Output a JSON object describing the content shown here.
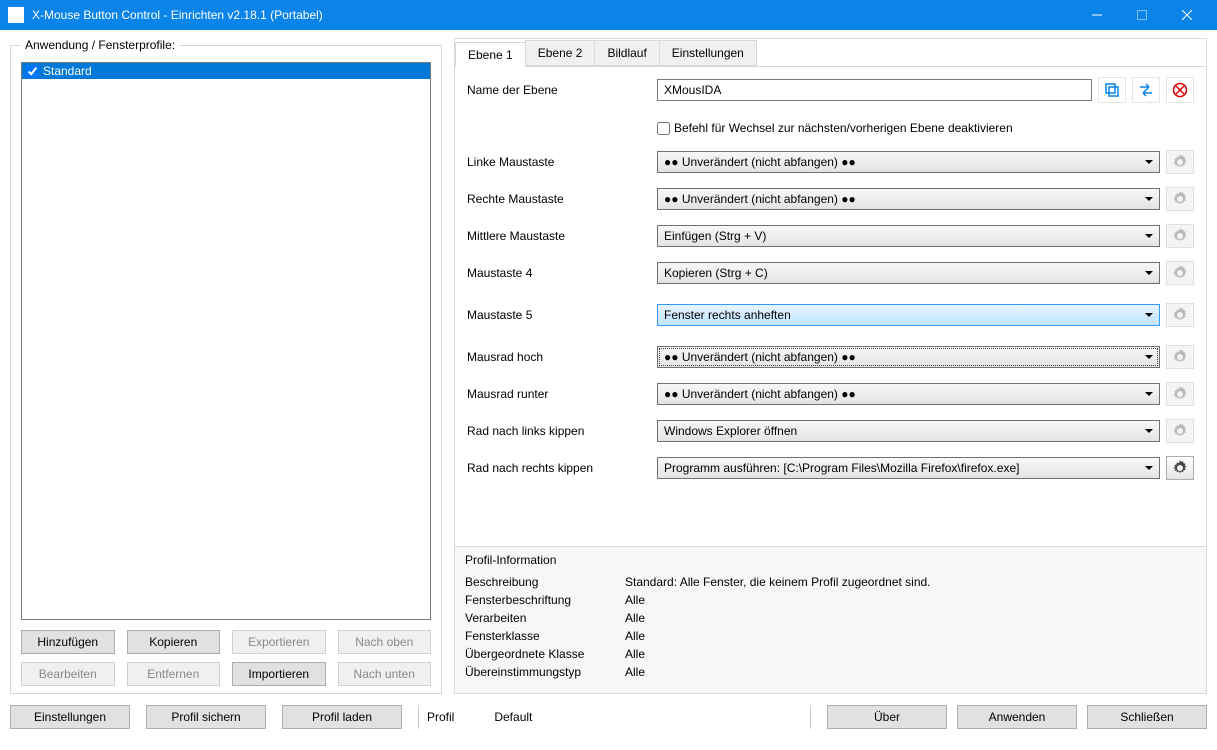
{
  "window": {
    "title": "X-Mouse Button Control - Einrichten v2.18.1 (Portabel)"
  },
  "leftPanel": {
    "legend": "Anwendung / Fensterprofile:",
    "items": [
      {
        "label": "Standard",
        "checked": true,
        "selected": true
      }
    ],
    "buttons": {
      "add": "Hinzufügen",
      "copy": "Kopieren",
      "export": "Exportieren",
      "moveUp": "Nach oben",
      "edit": "Bearbeiten",
      "remove": "Entfernen",
      "import": "Importieren",
      "moveDown": "Nach unten"
    }
  },
  "tabs": {
    "layer1": "Ebene 1",
    "layer2": "Ebene 2",
    "scroll": "Bildlauf",
    "settings": "Einstellungen"
  },
  "layerForm": {
    "nameLabel": "Name der Ebene",
    "nameValue": "XMousIDA",
    "disableSwitchLabel": "Befehl für Wechsel zur nächsten/vorherigen Ebene deaktivieren",
    "rows": [
      {
        "label": "Linke Maustaste",
        "value": "●● Unverändert (nicht abfangen) ●●",
        "gearEnabled": false,
        "highlight": false,
        "dashed": false
      },
      {
        "label": "Rechte Maustaste",
        "value": "●● Unverändert (nicht abfangen) ●●",
        "gearEnabled": false,
        "highlight": false,
        "dashed": false
      },
      {
        "label": "Mittlere Maustaste",
        "value": "Einfügen (Strg + V)",
        "gearEnabled": false,
        "highlight": false,
        "dashed": false
      },
      {
        "label": "Maustaste 4",
        "value": "Kopieren (Strg + C)",
        "gearEnabled": false,
        "highlight": false,
        "dashed": false
      },
      {
        "label": "Maustaste 5",
        "value": "Fenster rechts anheften",
        "gearEnabled": false,
        "highlight": true,
        "dashed": false
      },
      {
        "label": "Mausrad hoch",
        "value": "●● Unverändert (nicht abfangen) ●●",
        "gearEnabled": false,
        "highlight": false,
        "dashed": true
      },
      {
        "label": "Mausrad runter",
        "value": "●● Unverändert (nicht abfangen) ●●",
        "gearEnabled": false,
        "highlight": false,
        "dashed": false
      },
      {
        "label": "Rad nach links kippen",
        "value": "Windows Explorer öffnen",
        "gearEnabled": false,
        "highlight": false,
        "dashed": false
      },
      {
        "label": "Rad nach rechts kippen",
        "value": "Programm ausführen: [C:\\Program Files\\Mozilla Firefox\\firefox.exe]",
        "gearEnabled": true,
        "highlight": false,
        "dashed": false
      }
    ]
  },
  "profileInfo": {
    "title": "Profil-Information",
    "rows": [
      {
        "label": "Beschreibung",
        "value": "Standard: Alle Fenster, die keinem Profil zugeordnet sind."
      },
      {
        "label": "Fensterbeschriftung",
        "value": "Alle"
      },
      {
        "label": "Verarbeiten",
        "value": "Alle"
      },
      {
        "label": "Fensterklasse",
        "value": "Alle"
      },
      {
        "label": "Übergeordnete Klasse",
        "value": "Alle"
      },
      {
        "label": "Übereinstimmungstyp",
        "value": "Alle"
      }
    ]
  },
  "bottom": {
    "settings": "Einstellungen",
    "saveProfile": "Profil sichern",
    "loadProfile": "Profil laden",
    "profileLabel": "Profil",
    "profileValue": "Default",
    "about": "Über",
    "apply": "Anwenden",
    "close": "Schließen"
  }
}
